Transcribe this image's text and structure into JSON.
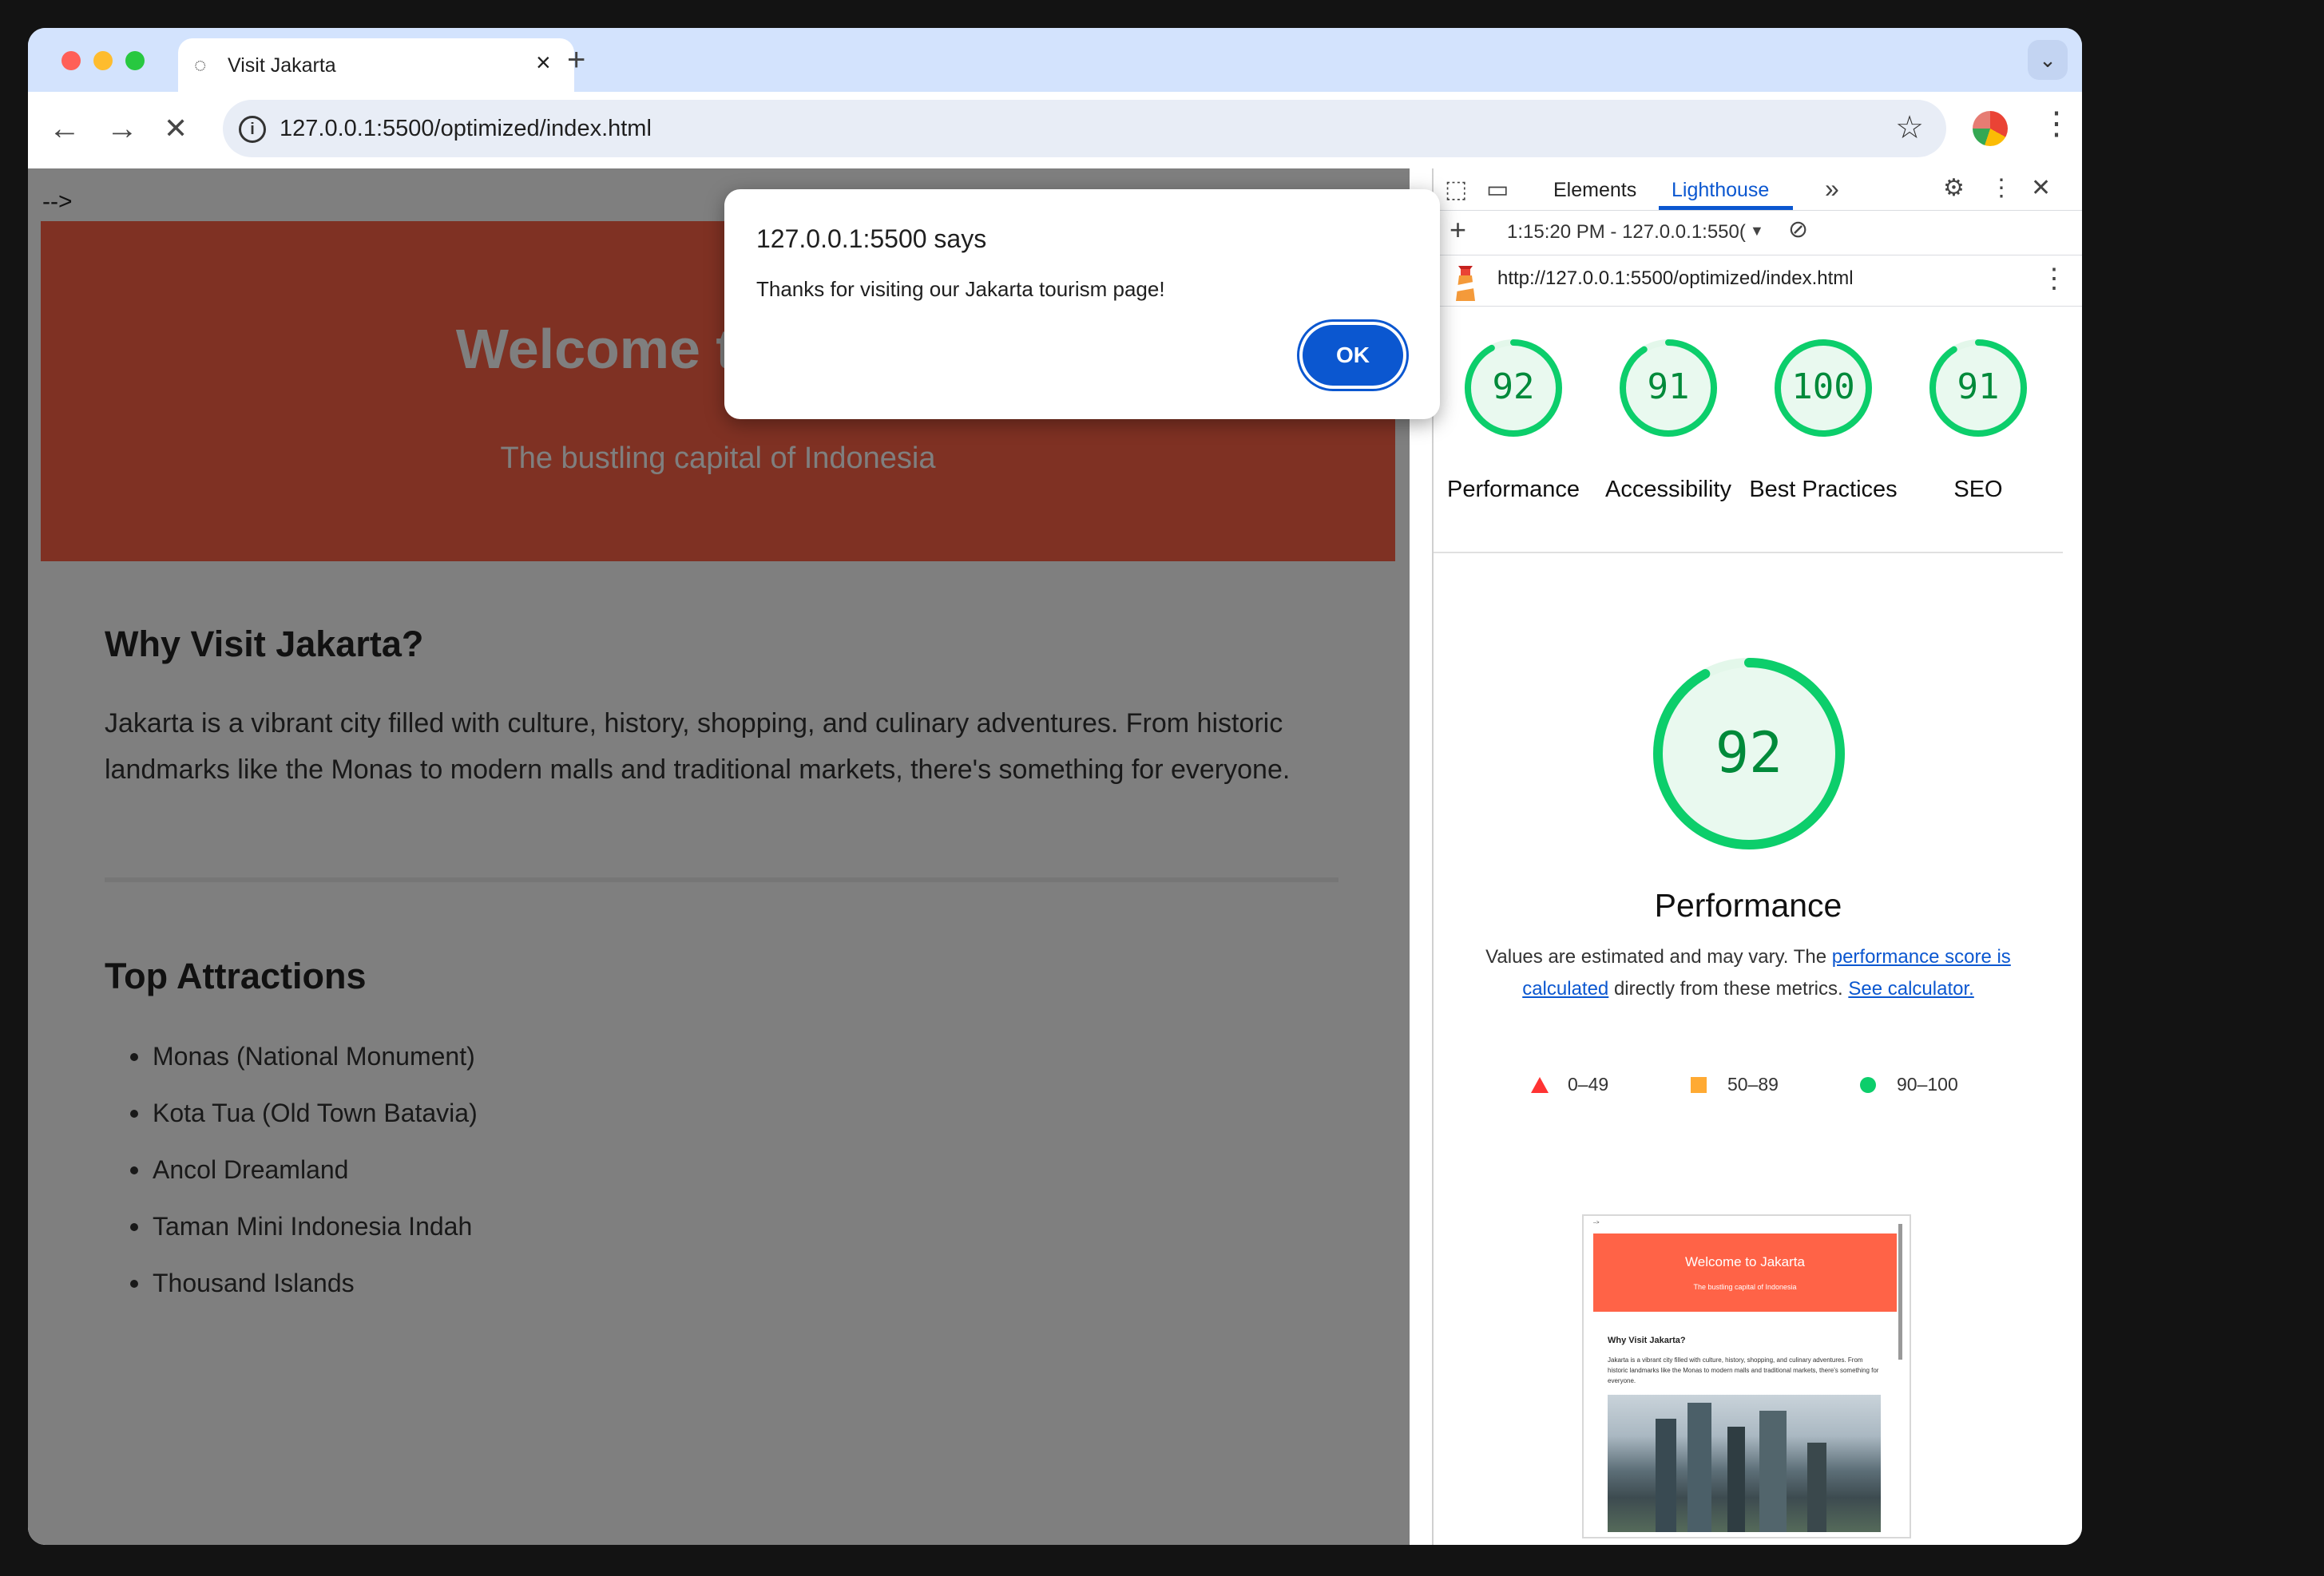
{
  "browser": {
    "tab_title": "Visit Jakarta",
    "url": "127.0.0.1:5500/optimized/index.html"
  },
  "page": {
    "comment_arrow": "-->",
    "hero_title": "Welcome to Jakarta",
    "hero_subtitle": "The bustling capital of Indonesia",
    "why_heading": "Why Visit Jakarta?",
    "why_text": "Jakarta is a vibrant city filled with culture, history, shopping, and culinary adventures. From historic landmarks like the Monas to modern malls and traditional markets, there's something for everyone.",
    "attractions_heading": "Top Attractions",
    "attractions": [
      "Monas (National Monument)",
      "Kota Tua (Old Town Batavia)",
      "Ancol Dreamland",
      "Taman Mini Indonesia Indah",
      "Thousand Islands"
    ]
  },
  "dialog": {
    "title": "127.0.0.1:5500 says",
    "message": "Thanks for visiting our Jakarta tourism page!",
    "ok_label": "OK"
  },
  "devtools": {
    "tabs": [
      "Elements",
      "Lighthouse"
    ],
    "report_time": "1:15:20 PM - 127.0.0.1:550(",
    "report_url": "http://127.0.0.1:5500/optimized/index.html",
    "scores": [
      {
        "label": "Performance",
        "value": "92"
      },
      {
        "label": "Accessibility",
        "value": "91"
      },
      {
        "label": "Best Practices",
        "value": "100"
      },
      {
        "label": "SEO",
        "value": "91"
      }
    ],
    "main_score": "92",
    "main_title": "Performance",
    "desc_prefix": "Values are estimated and may vary. The ",
    "desc_link1": "performance score is calculated",
    "desc_mid": " directly from these metrics. ",
    "desc_link2": "See calculator.",
    "legend": [
      {
        "range": "0–49",
        "color": "#ff3333"
      },
      {
        "range": "50–89",
        "color": "#ffaa33"
      },
      {
        "range": "90–100",
        "color": "#0cce6b"
      }
    ],
    "thumbnail": {
      "hero_title": "Welcome to Jakarta",
      "hero_subtitle": "The bustling capital of Indonesia",
      "heading": "Why Visit Jakarta?",
      "text": "Jakarta is a vibrant city filled with culture, history, shopping, and culinary adventures. From historic landmarks like the Monas to modern malls and traditional markets, there's something for everyone."
    }
  },
  "colors": {
    "accent": "#0b57d0",
    "hero": "#ff6347",
    "score_good": "#0cce6b"
  }
}
